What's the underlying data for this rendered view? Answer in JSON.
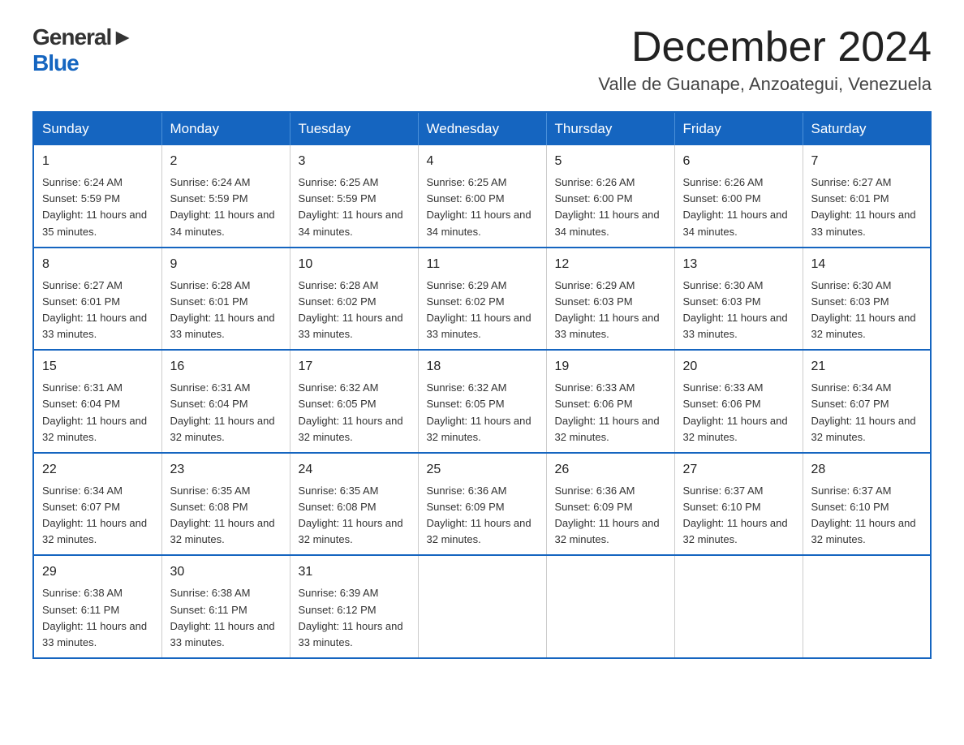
{
  "header": {
    "logo_general": "General",
    "logo_blue": "Blue",
    "title": "December 2024",
    "subtitle": "Valle de Guanape, Anzoategui, Venezuela"
  },
  "calendar": {
    "days": [
      "Sunday",
      "Monday",
      "Tuesday",
      "Wednesday",
      "Thursday",
      "Friday",
      "Saturday"
    ],
    "weeks": [
      [
        {
          "day": "1",
          "sunrise": "6:24 AM",
          "sunset": "5:59 PM",
          "daylight": "11 hours and 35 minutes."
        },
        {
          "day": "2",
          "sunrise": "6:24 AM",
          "sunset": "5:59 PM",
          "daylight": "11 hours and 34 minutes."
        },
        {
          "day": "3",
          "sunrise": "6:25 AM",
          "sunset": "5:59 PM",
          "daylight": "11 hours and 34 minutes."
        },
        {
          "day": "4",
          "sunrise": "6:25 AM",
          "sunset": "6:00 PM",
          "daylight": "11 hours and 34 minutes."
        },
        {
          "day": "5",
          "sunrise": "6:26 AM",
          "sunset": "6:00 PM",
          "daylight": "11 hours and 34 minutes."
        },
        {
          "day": "6",
          "sunrise": "6:26 AM",
          "sunset": "6:00 PM",
          "daylight": "11 hours and 34 minutes."
        },
        {
          "day": "7",
          "sunrise": "6:27 AM",
          "sunset": "6:01 PM",
          "daylight": "11 hours and 33 minutes."
        }
      ],
      [
        {
          "day": "8",
          "sunrise": "6:27 AM",
          "sunset": "6:01 PM",
          "daylight": "11 hours and 33 minutes."
        },
        {
          "day": "9",
          "sunrise": "6:28 AM",
          "sunset": "6:01 PM",
          "daylight": "11 hours and 33 minutes."
        },
        {
          "day": "10",
          "sunrise": "6:28 AM",
          "sunset": "6:02 PM",
          "daylight": "11 hours and 33 minutes."
        },
        {
          "day": "11",
          "sunrise": "6:29 AM",
          "sunset": "6:02 PM",
          "daylight": "11 hours and 33 minutes."
        },
        {
          "day": "12",
          "sunrise": "6:29 AM",
          "sunset": "6:03 PM",
          "daylight": "11 hours and 33 minutes."
        },
        {
          "day": "13",
          "sunrise": "6:30 AM",
          "sunset": "6:03 PM",
          "daylight": "11 hours and 33 minutes."
        },
        {
          "day": "14",
          "sunrise": "6:30 AM",
          "sunset": "6:03 PM",
          "daylight": "11 hours and 32 minutes."
        }
      ],
      [
        {
          "day": "15",
          "sunrise": "6:31 AM",
          "sunset": "6:04 PM",
          "daylight": "11 hours and 32 minutes."
        },
        {
          "day": "16",
          "sunrise": "6:31 AM",
          "sunset": "6:04 PM",
          "daylight": "11 hours and 32 minutes."
        },
        {
          "day": "17",
          "sunrise": "6:32 AM",
          "sunset": "6:05 PM",
          "daylight": "11 hours and 32 minutes."
        },
        {
          "day": "18",
          "sunrise": "6:32 AM",
          "sunset": "6:05 PM",
          "daylight": "11 hours and 32 minutes."
        },
        {
          "day": "19",
          "sunrise": "6:33 AM",
          "sunset": "6:06 PM",
          "daylight": "11 hours and 32 minutes."
        },
        {
          "day": "20",
          "sunrise": "6:33 AM",
          "sunset": "6:06 PM",
          "daylight": "11 hours and 32 minutes."
        },
        {
          "day": "21",
          "sunrise": "6:34 AM",
          "sunset": "6:07 PM",
          "daylight": "11 hours and 32 minutes."
        }
      ],
      [
        {
          "day": "22",
          "sunrise": "6:34 AM",
          "sunset": "6:07 PM",
          "daylight": "11 hours and 32 minutes."
        },
        {
          "day": "23",
          "sunrise": "6:35 AM",
          "sunset": "6:08 PM",
          "daylight": "11 hours and 32 minutes."
        },
        {
          "day": "24",
          "sunrise": "6:35 AM",
          "sunset": "6:08 PM",
          "daylight": "11 hours and 32 minutes."
        },
        {
          "day": "25",
          "sunrise": "6:36 AM",
          "sunset": "6:09 PM",
          "daylight": "11 hours and 32 minutes."
        },
        {
          "day": "26",
          "sunrise": "6:36 AM",
          "sunset": "6:09 PM",
          "daylight": "11 hours and 32 minutes."
        },
        {
          "day": "27",
          "sunrise": "6:37 AM",
          "sunset": "6:10 PM",
          "daylight": "11 hours and 32 minutes."
        },
        {
          "day": "28",
          "sunrise": "6:37 AM",
          "sunset": "6:10 PM",
          "daylight": "11 hours and 32 minutes."
        }
      ],
      [
        {
          "day": "29",
          "sunrise": "6:38 AM",
          "sunset": "6:11 PM",
          "daylight": "11 hours and 33 minutes."
        },
        {
          "day": "30",
          "sunrise": "6:38 AM",
          "sunset": "6:11 PM",
          "daylight": "11 hours and 33 minutes."
        },
        {
          "day": "31",
          "sunrise": "6:39 AM",
          "sunset": "6:12 PM",
          "daylight": "11 hours and 33 minutes."
        },
        null,
        null,
        null,
        null
      ]
    ]
  }
}
